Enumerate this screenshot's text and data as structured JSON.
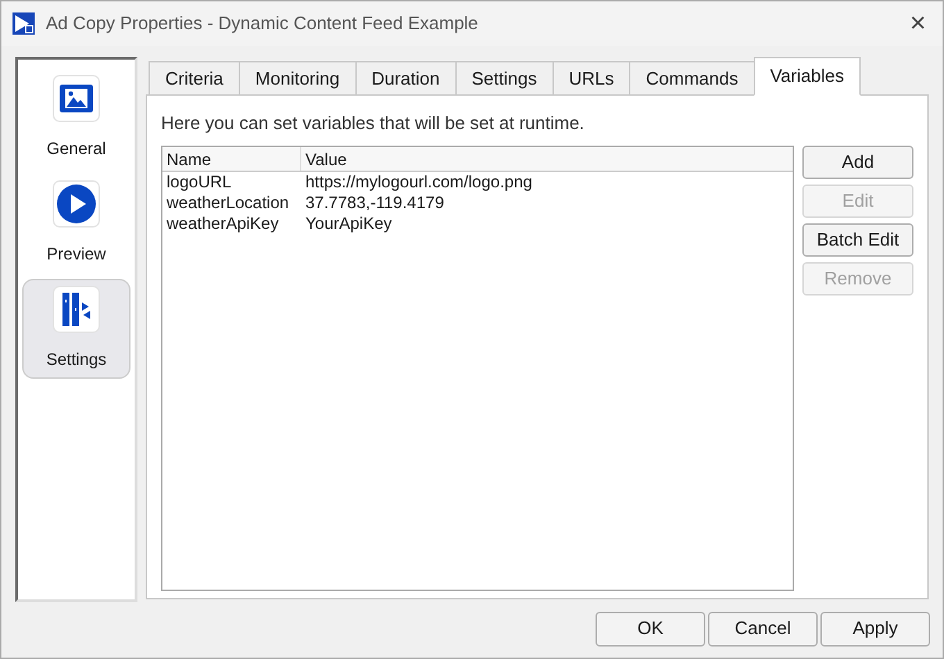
{
  "window": {
    "title": "Ad Copy Properties - Dynamic Content Feed Example",
    "close": "×"
  },
  "sidebar": {
    "items": [
      {
        "label": "General",
        "kind": "media",
        "selected": false
      },
      {
        "label": "Preview",
        "kind": "play",
        "selected": false
      },
      {
        "label": "Settings",
        "kind": "settings",
        "selected": true
      }
    ]
  },
  "tabs": [
    {
      "label": "Criteria",
      "selected": false
    },
    {
      "label": "Monitoring",
      "selected": false
    },
    {
      "label": "Duration",
      "selected": false
    },
    {
      "label": "Settings",
      "selected": false
    },
    {
      "label": "URLs",
      "selected": false
    },
    {
      "label": "Commands",
      "selected": false
    },
    {
      "label": "Variables",
      "selected": true
    }
  ],
  "description": "Here you can set variables that will be set at runtime.",
  "table": {
    "columns": [
      "Name",
      "Value"
    ],
    "rows": [
      [
        "logoURL",
        "https://mylogourl.com/logo.png"
      ],
      [
        "weatherLocation",
        "37.7783,-119.4179"
      ],
      [
        "weatherApiKey",
        "YourApiKey"
      ]
    ]
  },
  "side_buttons": [
    {
      "label": "Add",
      "disabled": false
    },
    {
      "label": "Edit",
      "disabled": true
    },
    {
      "label": "Batch Edit",
      "disabled": false
    },
    {
      "label": "Remove",
      "disabled": true
    }
  ],
  "footer_buttons": [
    "OK",
    "Cancel",
    "Apply"
  ]
}
